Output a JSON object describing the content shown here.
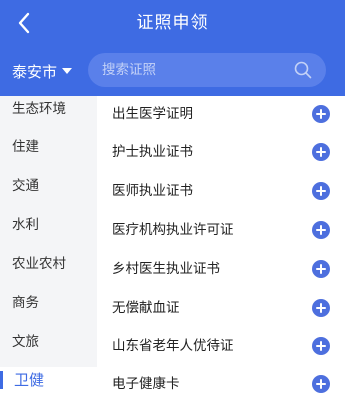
{
  "header": {
    "title": "证照申领",
    "back_icon": "chevron-left-icon"
  },
  "location": {
    "city": "泰安市",
    "dropdown_icon": "caret-down-icon"
  },
  "search": {
    "placeholder": "搜索证照",
    "icon": "search-icon"
  },
  "sidebar": {
    "items": [
      {
        "label": "生态环境"
      },
      {
        "label": "住建"
      },
      {
        "label": "交通"
      },
      {
        "label": "水利"
      },
      {
        "label": "农业农村"
      },
      {
        "label": "商务"
      },
      {
        "label": "文旅"
      },
      {
        "label": "卫健"
      }
    ],
    "active": "卫健"
  },
  "certificates": {
    "add_icon": "plus-circle-icon",
    "items": [
      {
        "label": "出生医学证明"
      },
      {
        "label": "护士执业证书"
      },
      {
        "label": "医师执业证书"
      },
      {
        "label": "医疗机构执业许可证"
      },
      {
        "label": "乡村医生执业证书"
      },
      {
        "label": "无偿献血证"
      },
      {
        "label": "山东省老年人优待证"
      },
      {
        "label": "电子健康卡"
      }
    ]
  },
  "colors": {
    "primary": "#3e6be3",
    "search_bg": "#5a80ea",
    "sidebar_bg": "#f4f5f7",
    "add_button": "#4d6fde"
  }
}
